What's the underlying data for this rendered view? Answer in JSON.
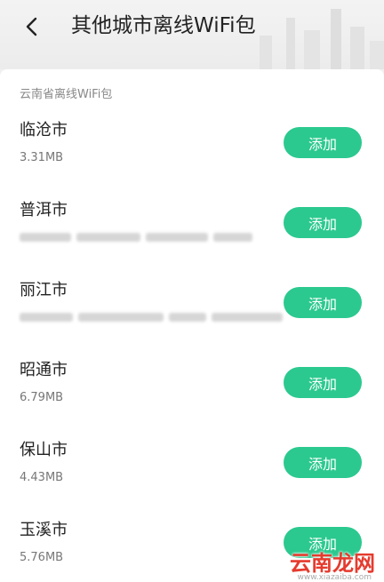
{
  "header": {
    "title": "其他城市离线WiFi包",
    "back_icon": "chevron-left-icon"
  },
  "section": {
    "label": "云南省离线WiFi包"
  },
  "cities": [
    {
      "name": "临沧市",
      "size": "3.31MB",
      "button": "添加"
    },
    {
      "name": "普洱市",
      "size": "",
      "button": "添加"
    },
    {
      "name": "丽江市",
      "size": "",
      "button": "添加"
    },
    {
      "name": "昭通市",
      "size": "6.79MB",
      "button": "添加"
    },
    {
      "name": "保山市",
      "size": "4.43MB",
      "button": "添加"
    },
    {
      "name": "玉溪市",
      "size": "5.76MB",
      "button": "添加"
    }
  ],
  "watermark": {
    "brand": "云南龙网",
    "url": "www.xiazaiba.com"
  },
  "colors": {
    "accent": "#2bc98f",
    "watermark": "#e53b2e"
  }
}
